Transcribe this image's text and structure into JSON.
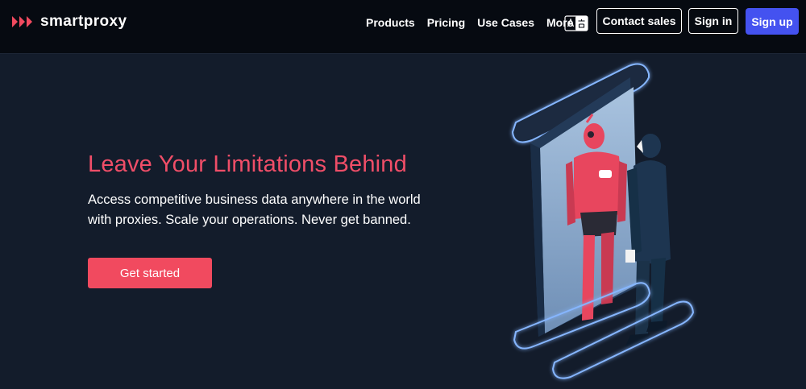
{
  "brand": {
    "name": "smartproxy",
    "color": "#f14a5f"
  },
  "nav": {
    "links": [
      "Products",
      "Pricing",
      "Use Cases",
      "More"
    ],
    "language_icon": "translate-icon",
    "contact_sales": "Contact sales",
    "sign_in": "Sign in",
    "sign_up": "Sign up"
  },
  "hero": {
    "title": "Leave Your Limitations Behind",
    "subtitle_line1": "Access competitive business data anywhere in the world",
    "subtitle_line2": "with proxies. Scale your operations. Never get banned.",
    "cta": "Get started"
  },
  "colors": {
    "background": "#131c2b",
    "navbar": "#060a11",
    "accent": "#f14a5f",
    "signup": "#4452f0"
  }
}
